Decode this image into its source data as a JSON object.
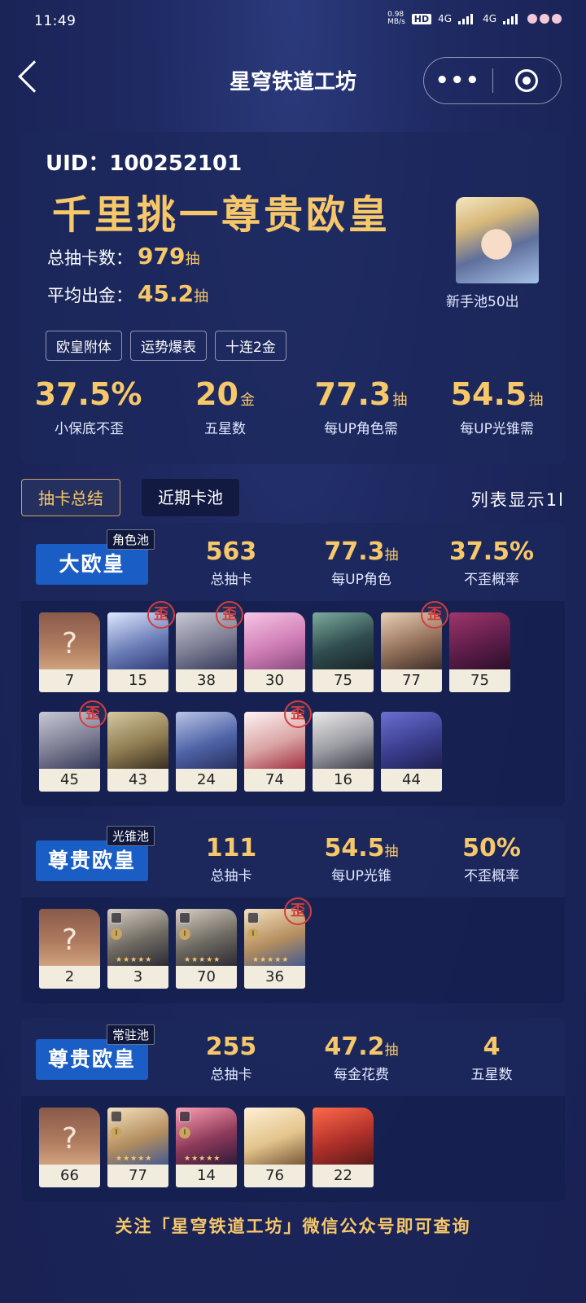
{
  "status": {
    "time": "11:49",
    "speed": "0.98\nMB/s",
    "net1": "4G",
    "net2": "4G"
  },
  "nav": {
    "title": "星穹铁道工坊"
  },
  "summary": {
    "uid": "UID：100252101",
    "rank_title": "千里挑一尊贵欧皇",
    "total_label": "总抽卡数：",
    "total_value": "979",
    "total_unit": "抽",
    "avg_label": "平均出金：",
    "avg_value": "45.2",
    "avg_unit": "抽",
    "avatar_caption": "新手池50出",
    "tags": [
      "欧皇附体",
      "运势爆表",
      "十连2金"
    ],
    "stats": [
      {
        "value": "37.5%",
        "unit": "",
        "label": "小保底不歪"
      },
      {
        "value": "20",
        "unit": "金",
        "label": "五星数"
      },
      {
        "value": "77.3",
        "unit": "抽",
        "label": "每UP角色需"
      },
      {
        "value": "54.5",
        "unit": "抽",
        "label": "每UP光锥需"
      }
    ]
  },
  "tabs": {
    "active": "抽卡总结",
    "inactive": "近期卡池",
    "list_mode": "列表显示1l"
  },
  "pools": [
    {
      "tag": "角色池",
      "rank": "大欧皇",
      "stats": [
        {
          "value": "563",
          "unit": "",
          "label": "总抽卡"
        },
        {
          "value": "77.3",
          "unit": "抽",
          "label": "每UP角色"
        },
        {
          "value": "37.5%",
          "unit": "",
          "label": "不歪概率"
        }
      ],
      "items": [
        {
          "count": "7",
          "unknown": true,
          "wai": false
        },
        {
          "count": "15",
          "wai": true
        },
        {
          "count": "38",
          "wai": true
        },
        {
          "count": "30",
          "wai": false
        },
        {
          "count": "75",
          "wai": false
        },
        {
          "count": "77",
          "wai": true
        },
        {
          "count": "75",
          "wai": false
        },
        {
          "count": "45",
          "wai": true
        },
        {
          "count": "43",
          "wai": false
        },
        {
          "count": "24",
          "wai": false
        },
        {
          "count": "74",
          "wai": true
        },
        {
          "count": "16",
          "wai": false
        },
        {
          "count": "44",
          "wai": false
        }
      ]
    },
    {
      "tag": "光锥池",
      "rank": "尊贵欧皇",
      "stats": [
        {
          "value": "111",
          "unit": "",
          "label": "总抽卡"
        },
        {
          "value": "54.5",
          "unit": "抽",
          "label": "每UP光锥"
        },
        {
          "value": "50%",
          "unit": "",
          "label": "不歪概率"
        }
      ],
      "items": [
        {
          "count": "2",
          "unknown": true,
          "wai": false
        },
        {
          "count": "3",
          "wai": false,
          "cone": true
        },
        {
          "count": "70",
          "wai": false,
          "cone": true
        },
        {
          "count": "36",
          "wai": true,
          "cone": true
        }
      ]
    },
    {
      "tag": "常驻池",
      "rank": "尊贵欧皇",
      "stats": [
        {
          "value": "255",
          "unit": "",
          "label": "总抽卡"
        },
        {
          "value": "47.2",
          "unit": "抽",
          "label": "每金花费"
        },
        {
          "value": "4",
          "unit": "",
          "label": "五星数"
        }
      ],
      "items": [
        {
          "count": "66",
          "unknown": true,
          "wai": false
        },
        {
          "count": "77",
          "wai": false,
          "cone": true
        },
        {
          "count": "14",
          "wai": false,
          "cone": true
        },
        {
          "count": "76",
          "wai": false
        },
        {
          "count": "22",
          "wai": false
        }
      ]
    }
  ],
  "wai_char": "歪",
  "question": "?",
  "footer": "关注「星穹铁道工坊」微信公众号即可查询"
}
